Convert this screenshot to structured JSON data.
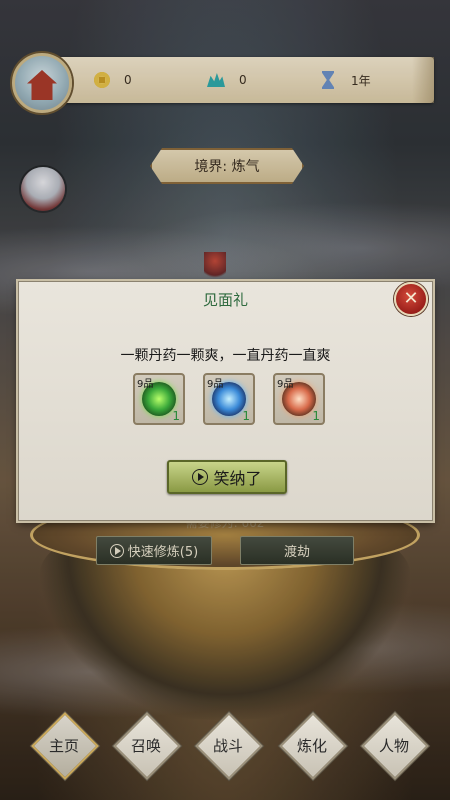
{
  "top_bar": {
    "coins": "0",
    "crystals": "0",
    "time": "1年"
  },
  "realm": {
    "label": "境界: 炼气"
  },
  "background": {
    "need_cultivation": "需要修为: 662",
    "quick_cultivate": "快速修炼(5)",
    "tribulation": "渡劫"
  },
  "modal": {
    "title": "见面礼",
    "close": "✕",
    "description": "一颗丹药一颗爽，一直丹药一直爽",
    "items": [
      {
        "grade": "9品",
        "qty": "1",
        "color": "#3aa83a",
        "icon": "green-pill-icon"
      },
      {
        "grade": "9品",
        "qty": "1",
        "color": "#3a8ad8",
        "icon": "blue-pill-icon"
      },
      {
        "grade": "9品",
        "qty": "1",
        "color": "#d86a4a",
        "icon": "red-pill-icon"
      }
    ],
    "accept_label": "笑纳了"
  },
  "nav": {
    "items": [
      {
        "label": "主页",
        "active": true
      },
      {
        "label": "召唤",
        "active": false
      },
      {
        "label": "战斗",
        "active": false
      },
      {
        "label": "炼化",
        "active": false
      },
      {
        "label": "人物",
        "active": false
      }
    ]
  }
}
